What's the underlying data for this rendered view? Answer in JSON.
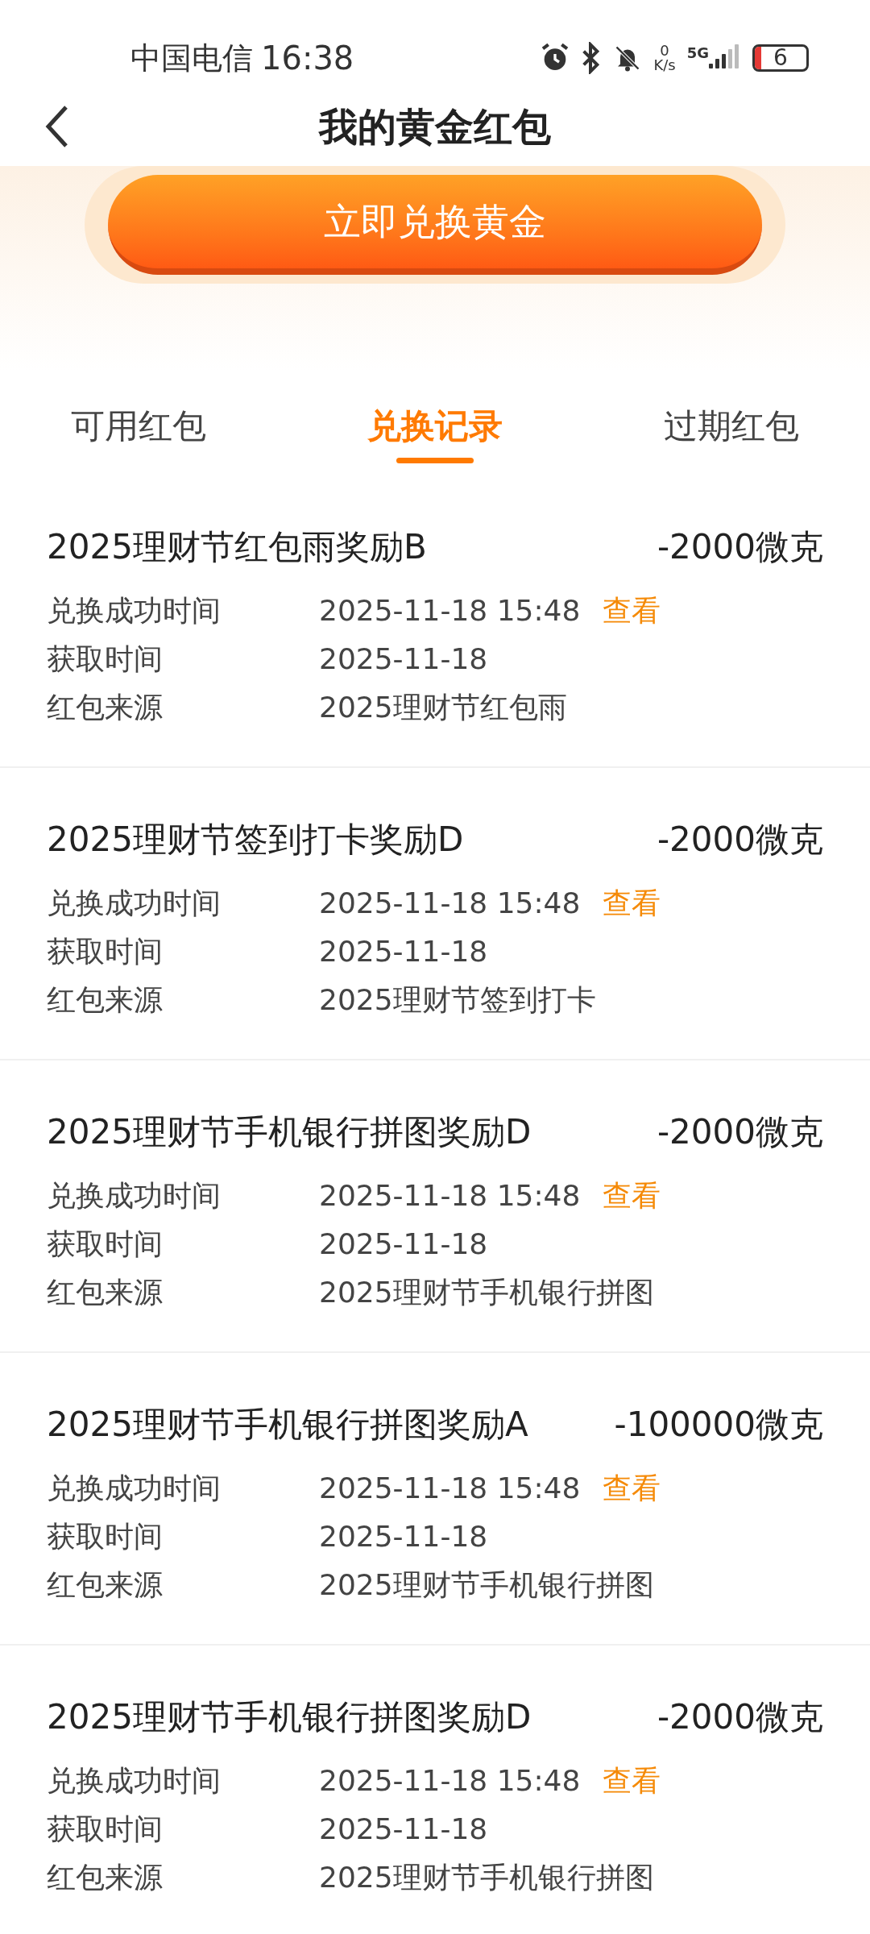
{
  "status_bar": {
    "carrier": "中国电信",
    "time": "16:38",
    "net_speed_value": "0",
    "net_speed_unit": "K/s",
    "network": "5G",
    "battery": "6"
  },
  "header": {
    "title": "我的黄金红包"
  },
  "exchange_button": {
    "label": "立即兑换黄金"
  },
  "tabs": [
    {
      "label": "可用红包",
      "selected": false
    },
    {
      "label": "兑换记录",
      "selected": true
    },
    {
      "label": "过期红包",
      "selected": false
    }
  ],
  "records": [
    {
      "title": "2025理财节红包雨奖励B",
      "amount": "-2000微克",
      "fields": [
        {
          "label": "兑换成功时间",
          "value": "2025-11-18 15:48",
          "link": "查看"
        },
        {
          "label": "获取时间",
          "value": "2025-11-18"
        },
        {
          "label": "红包来源",
          "value": "2025理财节红包雨"
        }
      ]
    },
    {
      "title": "2025理财节签到打卡奖励D",
      "amount": "-2000微克",
      "fields": [
        {
          "label": "兑换成功时间",
          "value": "2025-11-18 15:48",
          "link": "查看"
        },
        {
          "label": "获取时间",
          "value": "2025-11-18"
        },
        {
          "label": "红包来源",
          "value": "2025理财节签到打卡"
        }
      ]
    },
    {
      "title": "2025理财节手机银行拼图奖励D",
      "amount": "-2000微克",
      "fields": [
        {
          "label": "兑换成功时间",
          "value": "2025-11-18 15:48",
          "link": "查看"
        },
        {
          "label": "获取时间",
          "value": "2025-11-18"
        },
        {
          "label": "红包来源",
          "value": "2025理财节手机银行拼图"
        }
      ]
    },
    {
      "title": "2025理财节手机银行拼图奖励A",
      "amount": "-100000微克",
      "fields": [
        {
          "label": "兑换成功时间",
          "value": "2025-11-18 15:48",
          "link": "查看"
        },
        {
          "label": "获取时间",
          "value": "2025-11-18"
        },
        {
          "label": "红包来源",
          "value": "2025理财节手机银行拼图"
        }
      ]
    },
    {
      "title": "2025理财节手机银行拼图奖励D",
      "amount": "-2000微克",
      "fields": [
        {
          "label": "兑换成功时间",
          "value": "2025-11-18 15:48",
          "link": "查看"
        },
        {
          "label": "获取时间",
          "value": "2025-11-18"
        },
        {
          "label": "红包来源",
          "value": "2025理财节手机银行拼图"
        }
      ]
    }
  ]
}
